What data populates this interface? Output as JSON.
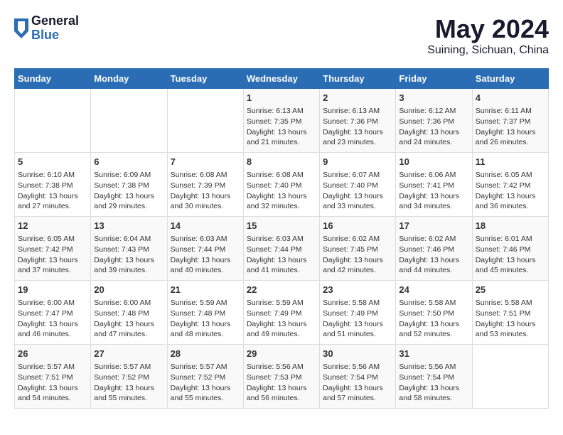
{
  "header": {
    "logo_general": "General",
    "logo_blue": "Blue",
    "main_title": "May 2024",
    "subtitle": "Suining, Sichuan, China"
  },
  "days_of_week": [
    "Sunday",
    "Monday",
    "Tuesday",
    "Wednesday",
    "Thursday",
    "Friday",
    "Saturday"
  ],
  "weeks": [
    [
      {
        "day": "",
        "info": ""
      },
      {
        "day": "",
        "info": ""
      },
      {
        "day": "",
        "info": ""
      },
      {
        "day": "1",
        "info": "Sunrise: 6:13 AM\nSunset: 7:35 PM\nDaylight: 13 hours\nand 21 minutes."
      },
      {
        "day": "2",
        "info": "Sunrise: 6:13 AM\nSunset: 7:36 PM\nDaylight: 13 hours\nand 23 minutes."
      },
      {
        "day": "3",
        "info": "Sunrise: 6:12 AM\nSunset: 7:36 PM\nDaylight: 13 hours\nand 24 minutes."
      },
      {
        "day": "4",
        "info": "Sunrise: 6:11 AM\nSunset: 7:37 PM\nDaylight: 13 hours\nand 26 minutes."
      }
    ],
    [
      {
        "day": "5",
        "info": "Sunrise: 6:10 AM\nSunset: 7:38 PM\nDaylight: 13 hours\nand 27 minutes."
      },
      {
        "day": "6",
        "info": "Sunrise: 6:09 AM\nSunset: 7:38 PM\nDaylight: 13 hours\nand 29 minutes."
      },
      {
        "day": "7",
        "info": "Sunrise: 6:08 AM\nSunset: 7:39 PM\nDaylight: 13 hours\nand 30 minutes."
      },
      {
        "day": "8",
        "info": "Sunrise: 6:08 AM\nSunset: 7:40 PM\nDaylight: 13 hours\nand 32 minutes."
      },
      {
        "day": "9",
        "info": "Sunrise: 6:07 AM\nSunset: 7:40 PM\nDaylight: 13 hours\nand 33 minutes."
      },
      {
        "day": "10",
        "info": "Sunrise: 6:06 AM\nSunset: 7:41 PM\nDaylight: 13 hours\nand 34 minutes."
      },
      {
        "day": "11",
        "info": "Sunrise: 6:05 AM\nSunset: 7:42 PM\nDaylight: 13 hours\nand 36 minutes."
      }
    ],
    [
      {
        "day": "12",
        "info": "Sunrise: 6:05 AM\nSunset: 7:42 PM\nDaylight: 13 hours\nand 37 minutes."
      },
      {
        "day": "13",
        "info": "Sunrise: 6:04 AM\nSunset: 7:43 PM\nDaylight: 13 hours\nand 39 minutes."
      },
      {
        "day": "14",
        "info": "Sunrise: 6:03 AM\nSunset: 7:44 PM\nDaylight: 13 hours\nand 40 minutes."
      },
      {
        "day": "15",
        "info": "Sunrise: 6:03 AM\nSunset: 7:44 PM\nDaylight: 13 hours\nand 41 minutes."
      },
      {
        "day": "16",
        "info": "Sunrise: 6:02 AM\nSunset: 7:45 PM\nDaylight: 13 hours\nand 42 minutes."
      },
      {
        "day": "17",
        "info": "Sunrise: 6:02 AM\nSunset: 7:46 PM\nDaylight: 13 hours\nand 44 minutes."
      },
      {
        "day": "18",
        "info": "Sunrise: 6:01 AM\nSunset: 7:46 PM\nDaylight: 13 hours\nand 45 minutes."
      }
    ],
    [
      {
        "day": "19",
        "info": "Sunrise: 6:00 AM\nSunset: 7:47 PM\nDaylight: 13 hours\nand 46 minutes."
      },
      {
        "day": "20",
        "info": "Sunrise: 6:00 AM\nSunset: 7:48 PM\nDaylight: 13 hours\nand 47 minutes."
      },
      {
        "day": "21",
        "info": "Sunrise: 5:59 AM\nSunset: 7:48 PM\nDaylight: 13 hours\nand 48 minutes."
      },
      {
        "day": "22",
        "info": "Sunrise: 5:59 AM\nSunset: 7:49 PM\nDaylight: 13 hours\nand 49 minutes."
      },
      {
        "day": "23",
        "info": "Sunrise: 5:58 AM\nSunset: 7:49 PM\nDaylight: 13 hours\nand 51 minutes."
      },
      {
        "day": "24",
        "info": "Sunrise: 5:58 AM\nSunset: 7:50 PM\nDaylight: 13 hours\nand 52 minutes."
      },
      {
        "day": "25",
        "info": "Sunrise: 5:58 AM\nSunset: 7:51 PM\nDaylight: 13 hours\nand 53 minutes."
      }
    ],
    [
      {
        "day": "26",
        "info": "Sunrise: 5:57 AM\nSunset: 7:51 PM\nDaylight: 13 hours\nand 54 minutes."
      },
      {
        "day": "27",
        "info": "Sunrise: 5:57 AM\nSunset: 7:52 PM\nDaylight: 13 hours\nand 55 minutes."
      },
      {
        "day": "28",
        "info": "Sunrise: 5:57 AM\nSunset: 7:52 PM\nDaylight: 13 hours\nand 55 minutes."
      },
      {
        "day": "29",
        "info": "Sunrise: 5:56 AM\nSunset: 7:53 PM\nDaylight: 13 hours\nand 56 minutes."
      },
      {
        "day": "30",
        "info": "Sunrise: 5:56 AM\nSunset: 7:54 PM\nDaylight: 13 hours\nand 57 minutes."
      },
      {
        "day": "31",
        "info": "Sunrise: 5:56 AM\nSunset: 7:54 PM\nDaylight: 13 hours\nand 58 minutes."
      },
      {
        "day": "",
        "info": ""
      }
    ]
  ]
}
